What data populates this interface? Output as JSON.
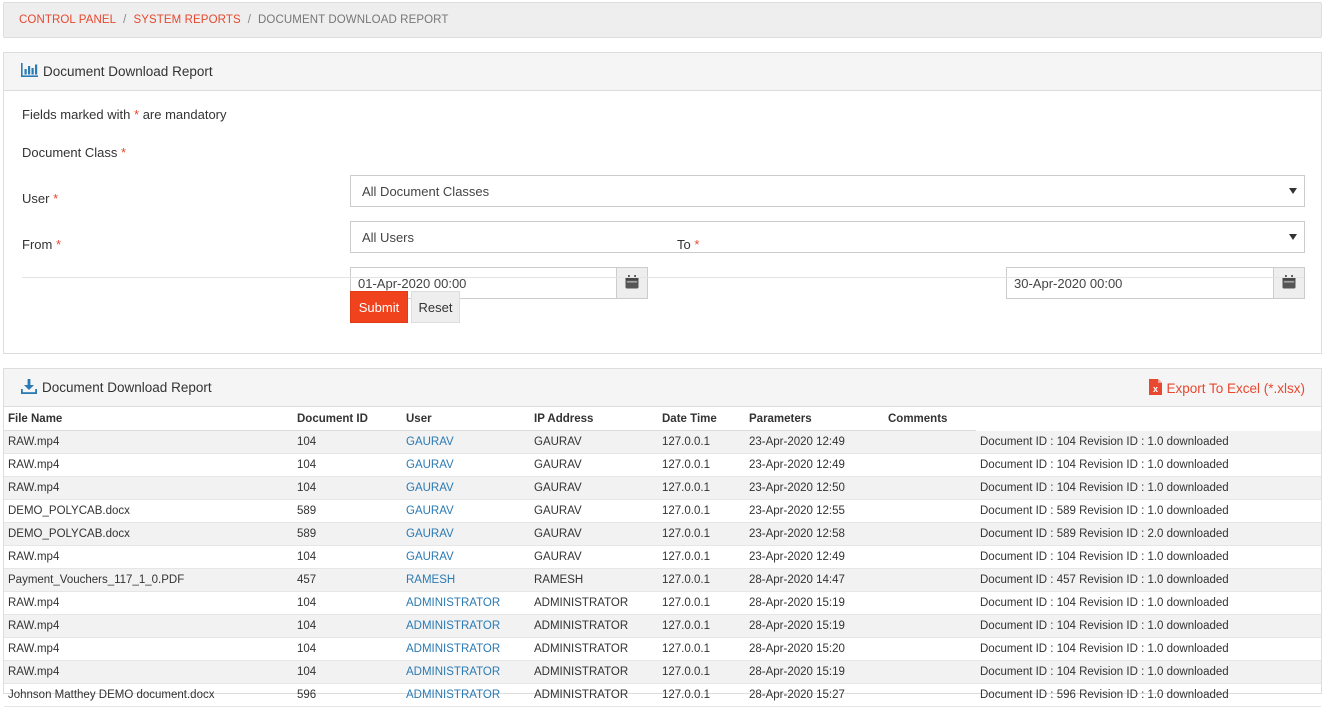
{
  "breadcrumb": {
    "items": [
      "CONTROL PANEL",
      "SYSTEM REPORTS"
    ],
    "separator": "/",
    "current": "DOCUMENT DOWNLOAD REPORT"
  },
  "form_panel": {
    "title": "Document Download Report",
    "mandatory_note_prefix": "Fields marked with",
    "mandatory_note_suffix": "are mandatory",
    "required_marker": "*",
    "document_class_label": "Document Class",
    "document_class_value": "All Document Classes",
    "user_label": "User",
    "user_value": "All Users",
    "from_label": "From",
    "from_value": "01-Apr-2020 00:00",
    "to_label": "To",
    "to_value": "30-Apr-2020 00:00",
    "submit_label": "Submit",
    "reset_label": "Reset"
  },
  "report_panel": {
    "title": "Document Download Report",
    "export_label": "Export To Excel (*.xlsx)",
    "columns": [
      "File Name",
      "Document ID",
      "User",
      "IP Address",
      "Date Time",
      "Parameters",
      "Comments"
    ],
    "rows": [
      [
        "RAW.mp4",
        "104",
        "GAURAV",
        "GAURAV",
        "127.0.0.1",
        "23-Apr-2020 12:49",
        "",
        "Document ID : 104 Revision ID : 1.0 downloaded"
      ],
      [
        "RAW.mp4",
        "104",
        "GAURAV",
        "GAURAV",
        "127.0.0.1",
        "23-Apr-2020 12:49",
        "",
        "Document ID : 104 Revision ID : 1.0 downloaded"
      ],
      [
        "RAW.mp4",
        "104",
        "GAURAV",
        "GAURAV",
        "127.0.0.1",
        "23-Apr-2020 12:50",
        "",
        "Document ID : 104 Revision ID : 1.0 downloaded"
      ],
      [
        "DEMO_POLYCAB.docx",
        "589",
        "GAURAV",
        "GAURAV",
        "127.0.0.1",
        "23-Apr-2020 12:55",
        "",
        "Document ID : 589 Revision ID : 1.0 downloaded"
      ],
      [
        "DEMO_POLYCAB.docx",
        "589",
        "GAURAV",
        "GAURAV",
        "127.0.0.1",
        "23-Apr-2020 12:58",
        "",
        "Document ID : 589 Revision ID : 2.0 downloaded"
      ],
      [
        "RAW.mp4",
        "104",
        "GAURAV",
        "GAURAV",
        "127.0.0.1",
        "23-Apr-2020 12:49",
        "",
        "Document ID : 104 Revision ID : 1.0 downloaded"
      ],
      [
        "Payment_Vouchers_117_1_0.PDF",
        "457",
        "RAMESH",
        "RAMESH",
        "127.0.0.1",
        "28-Apr-2020 14:47",
        "",
        "Document ID : 457 Revision ID : 1.0 downloaded"
      ],
      [
        "RAW.mp4",
        "104",
        "ADMINISTRATOR",
        "ADMINISTRATOR",
        "127.0.0.1",
        "28-Apr-2020 15:19",
        "",
        "Document ID : 104 Revision ID : 1.0 downloaded"
      ],
      [
        "RAW.mp4",
        "104",
        "ADMINISTRATOR",
        "ADMINISTRATOR",
        "127.0.0.1",
        "28-Apr-2020 15:19",
        "",
        "Document ID : 104 Revision ID : 1.0 downloaded"
      ],
      [
        "RAW.mp4",
        "104",
        "ADMINISTRATOR",
        "ADMINISTRATOR",
        "127.0.0.1",
        "28-Apr-2020 15:20",
        "",
        "Document ID : 104 Revision ID : 1.0 downloaded"
      ],
      [
        "RAW.mp4",
        "104",
        "ADMINISTRATOR",
        "ADMINISTRATOR",
        "127.0.0.1",
        "28-Apr-2020 15:19",
        "",
        "Document ID : 104 Revision ID : 1.0 downloaded"
      ],
      [
        "Johnson Matthey DEMO document.docx",
        "596",
        "ADMINISTRATOR",
        "ADMINISTRATOR",
        "127.0.0.1",
        "28-Apr-2020 15:27",
        "",
        "Document ID : 596 Revision ID : 1.0 downloaded"
      ]
    ]
  },
  "colors": {
    "accent": "#e7482f",
    "submit": "#f0421c",
    "link": "#2a7ab3",
    "icon_blue": "#2a7ab3",
    "excel_icon": "#e7482f"
  },
  "icons": {
    "form_title_icon": "bar-chart-icon",
    "report_title_icon": "download-icon",
    "export_icon": "excel-file-icon",
    "date_picker_icon": "calendar-icon",
    "select_caret_icon": "caret-down-icon"
  }
}
